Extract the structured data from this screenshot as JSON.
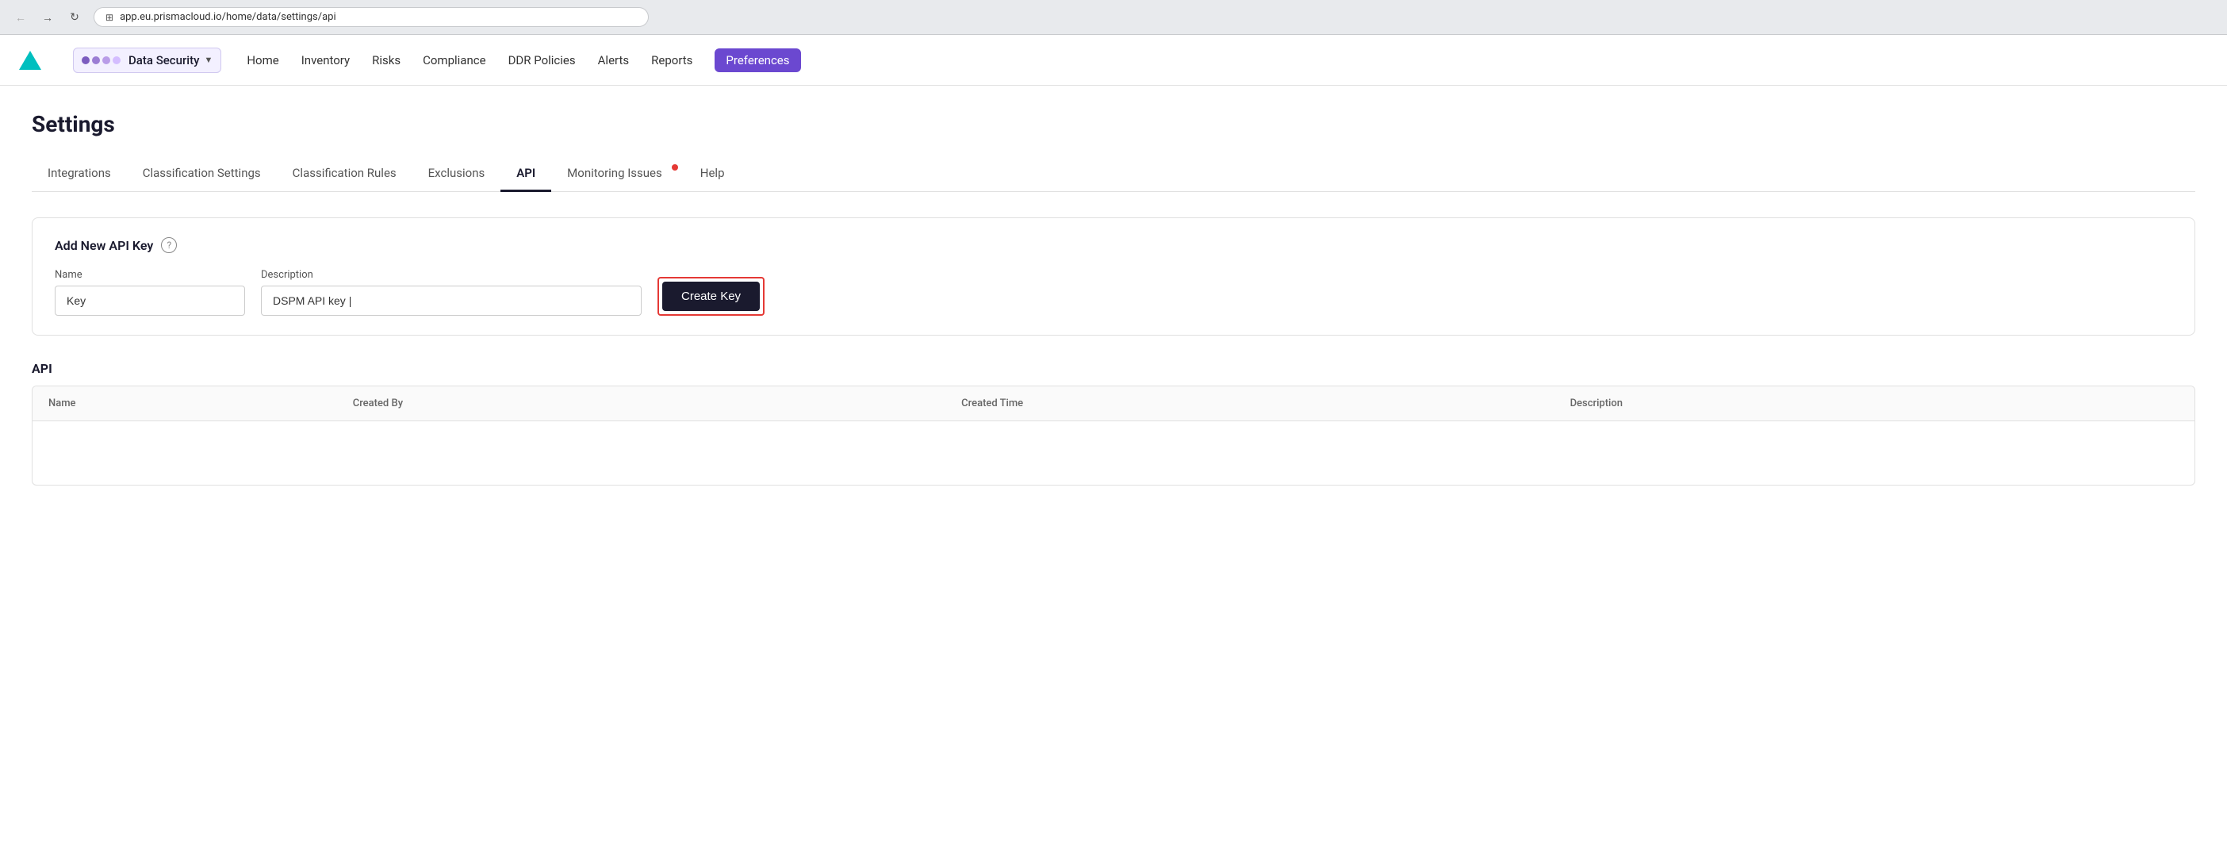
{
  "browser": {
    "url": "app.eu.prismacloud.io/home/data/settings/api",
    "url_icon": "🔒"
  },
  "nav": {
    "brand_name": "Data Security",
    "brand_dots": [
      "#7c5cbf",
      "#9b7dd4",
      "#b99ce8",
      "#d4bdff"
    ],
    "menu_items": [
      {
        "id": "home",
        "label": "Home",
        "active": false
      },
      {
        "id": "inventory",
        "label": "Inventory",
        "active": false
      },
      {
        "id": "risks",
        "label": "Risks",
        "active": false
      },
      {
        "id": "compliance",
        "label": "Compliance",
        "active": false
      },
      {
        "id": "ddr-policies",
        "label": "DDR Policies",
        "active": false
      },
      {
        "id": "alerts",
        "label": "Alerts",
        "active": false
      },
      {
        "id": "reports",
        "label": "Reports",
        "active": false
      },
      {
        "id": "preferences",
        "label": "Preferences",
        "active": true
      }
    ]
  },
  "page": {
    "title": "Settings"
  },
  "tabs": [
    {
      "id": "integrations",
      "label": "Integrations",
      "active": false,
      "badge": false
    },
    {
      "id": "classification-settings",
      "label": "Classification Settings",
      "active": false,
      "badge": false
    },
    {
      "id": "classification-rules",
      "label": "Classification Rules",
      "active": false,
      "badge": false
    },
    {
      "id": "exclusions",
      "label": "Exclusions",
      "active": false,
      "badge": false
    },
    {
      "id": "api",
      "label": "API",
      "active": true,
      "badge": false
    },
    {
      "id": "monitoring-issues",
      "label": "Monitoring Issues",
      "active": false,
      "badge": true
    },
    {
      "id": "help",
      "label": "Help",
      "active": false,
      "badge": false
    }
  ],
  "add_api_key": {
    "section_title": "Add New API Key",
    "help_icon_label": "?",
    "name_label": "Name",
    "name_value": "Key",
    "description_label": "Description",
    "description_value": "DSPM API key |",
    "create_button_label": "Create Key"
  },
  "api_table": {
    "section_title": "API",
    "columns": [
      "Name",
      "Created By",
      "Created Time",
      "Description"
    ],
    "rows": []
  }
}
